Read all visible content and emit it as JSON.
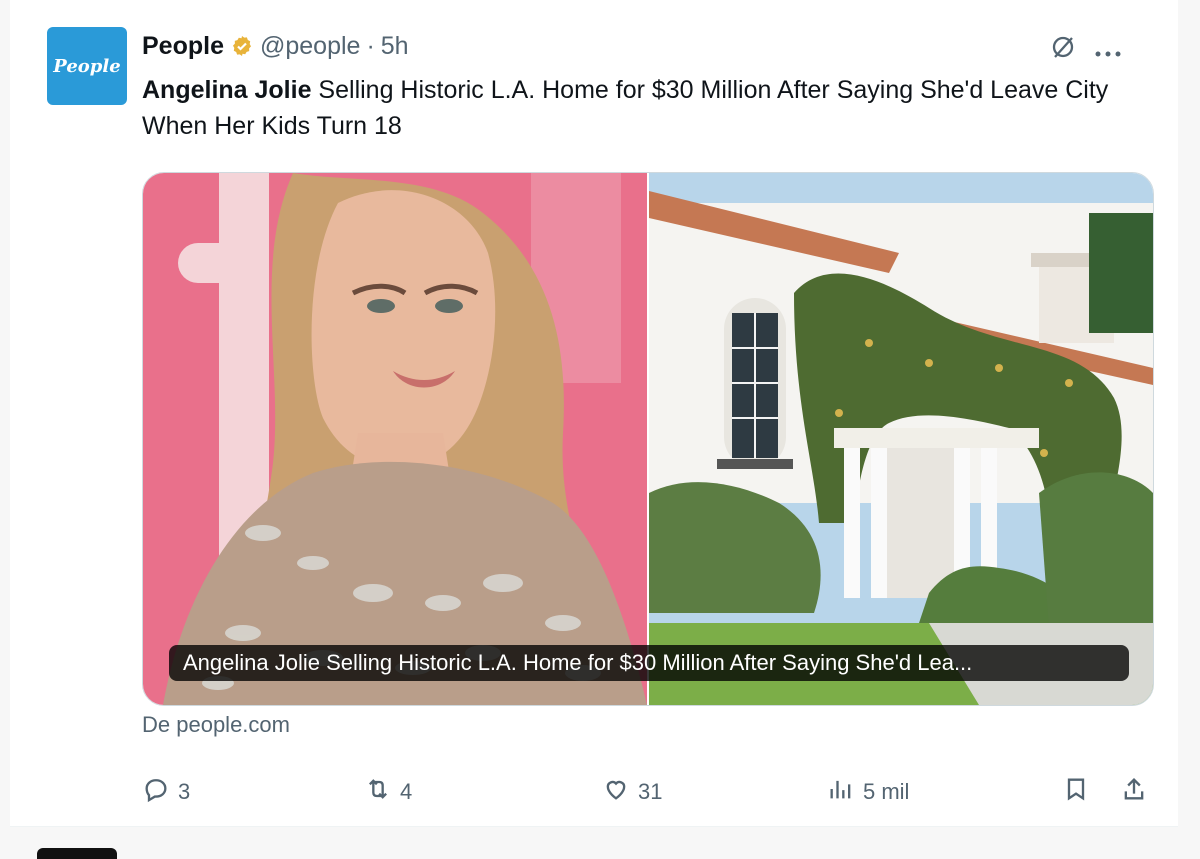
{
  "tweet": {
    "avatar_text": "People",
    "name": "People",
    "handle": "@people",
    "separator": "·",
    "time": "5h",
    "text_bold": "Angelina Jolie",
    "text_rest": " Selling Historic L.A. Home for $30 Million After Saying She'd Leave City When Her Kids Turn 18",
    "link_card_caption": "Angelina Jolie Selling Historic L.A. Home for $30 Million After Saying She'd Lea...",
    "source": "De people.com",
    "metrics": {
      "replies": "3",
      "reposts": "4",
      "likes": "31",
      "views": "5 mil"
    }
  },
  "colors": {
    "verified": "#e8b33a",
    "accent": "#1d9bf0",
    "muted": "#536471"
  },
  "icons": {
    "grok": "slashed-circle-icon",
    "more": "more-icon",
    "reply": "reply-icon",
    "repost": "repost-icon",
    "like": "like-icon",
    "views": "views-icon",
    "bookmark": "bookmark-icon",
    "share": "share-icon"
  }
}
